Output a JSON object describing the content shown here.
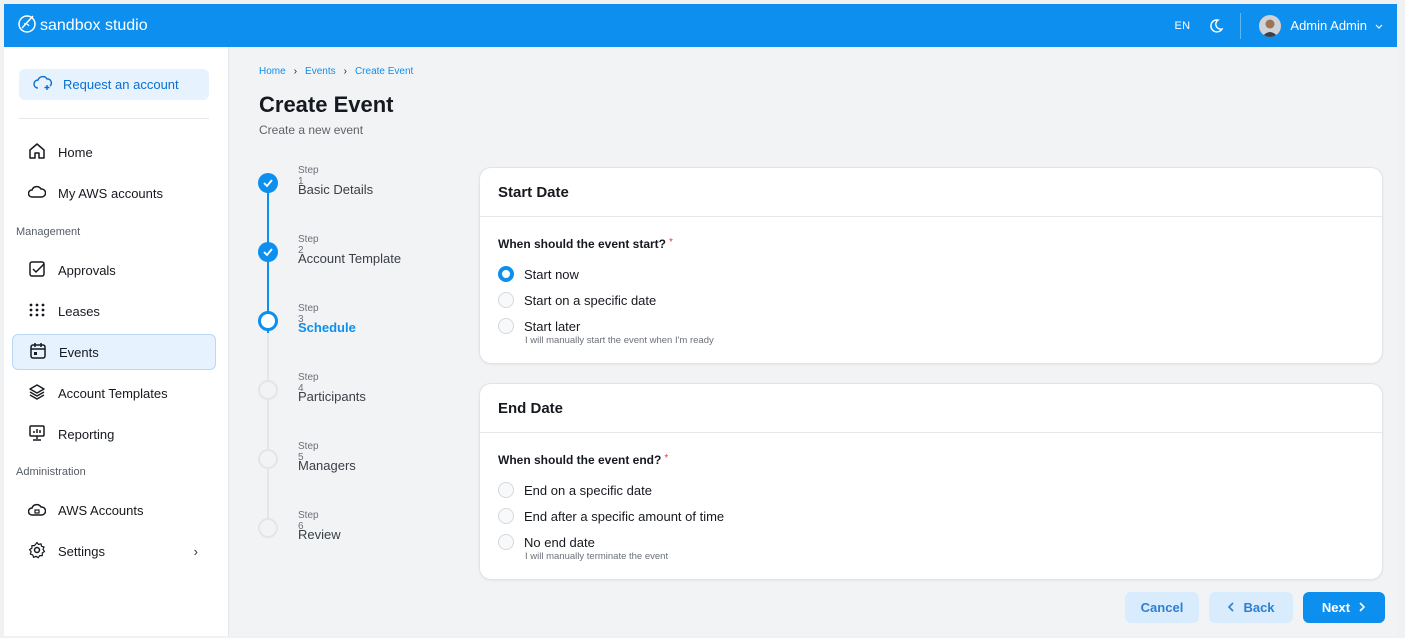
{
  "header": {
    "brand": "sandbox studio",
    "language": "EN",
    "user_name": "Admin Admin",
    "icons": {
      "logo": "sandbox-logo-icon",
      "theme": "moon-icon",
      "user_menu": "chevron-down-icon"
    }
  },
  "sidebar": {
    "request_button": "Request an account",
    "items": [
      {
        "label": "Home",
        "icon": "home-icon"
      },
      {
        "label": "My AWS accounts",
        "icon": "cloud-icon"
      },
      {
        "section": "Management"
      },
      {
        "label": "Approvals",
        "icon": "check-square-icon"
      },
      {
        "label": "Leases",
        "icon": "grid-dots-icon"
      },
      {
        "label": "Events",
        "icon": "calendar-icon",
        "active": true
      },
      {
        "label": "Account Templates",
        "icon": "layers-icon"
      },
      {
        "label": "Reporting",
        "icon": "presentation-icon"
      },
      {
        "section": "Administration"
      },
      {
        "label": "AWS Accounts",
        "icon": "cloud-lock-icon"
      },
      {
        "label": "Settings",
        "icon": "gear-icon",
        "has_submenu": true
      }
    ],
    "section_management": "Management",
    "section_administration": "Administration"
  },
  "breadcrumb": [
    "Home",
    "Events",
    "Create Event"
  ],
  "page": {
    "title": "Create Event",
    "subtitle": "Create a new event"
  },
  "steps": [
    {
      "num": "Step 1",
      "label": "Basic Details",
      "state": "done"
    },
    {
      "num": "Step 2",
      "label": "Account Template",
      "state": "done"
    },
    {
      "num": "Step 3",
      "label": "Schedule",
      "state": "current"
    },
    {
      "num": "Step 4",
      "label": "Participants",
      "state": "todo"
    },
    {
      "num": "Step 5",
      "label": "Managers",
      "state": "todo"
    },
    {
      "num": "Step 6",
      "label": "Review",
      "state": "todo"
    }
  ],
  "start_date": {
    "title": "Start Date",
    "question": "When should the event start?",
    "required_mark": "*",
    "options": [
      {
        "label": "Start now",
        "selected": true
      },
      {
        "label": "Start on a specific date",
        "selected": false
      },
      {
        "label": "Start later",
        "selected": false,
        "desc": "I will manually start the event when I'm ready"
      }
    ]
  },
  "end_date": {
    "title": "End Date",
    "question": "When should the event end?",
    "required_mark": "*",
    "options": [
      {
        "label": "End on a specific date",
        "selected": false
      },
      {
        "label": "End after a specific amount of time",
        "selected": false
      },
      {
        "label": "No end date",
        "selected": false,
        "desc": "I will manually terminate the event"
      }
    ]
  },
  "actions": {
    "cancel": "Cancel",
    "back": "Back",
    "next": "Next"
  },
  "colors": {
    "primary": "#0d8fef",
    "required": "#e03e3e"
  }
}
